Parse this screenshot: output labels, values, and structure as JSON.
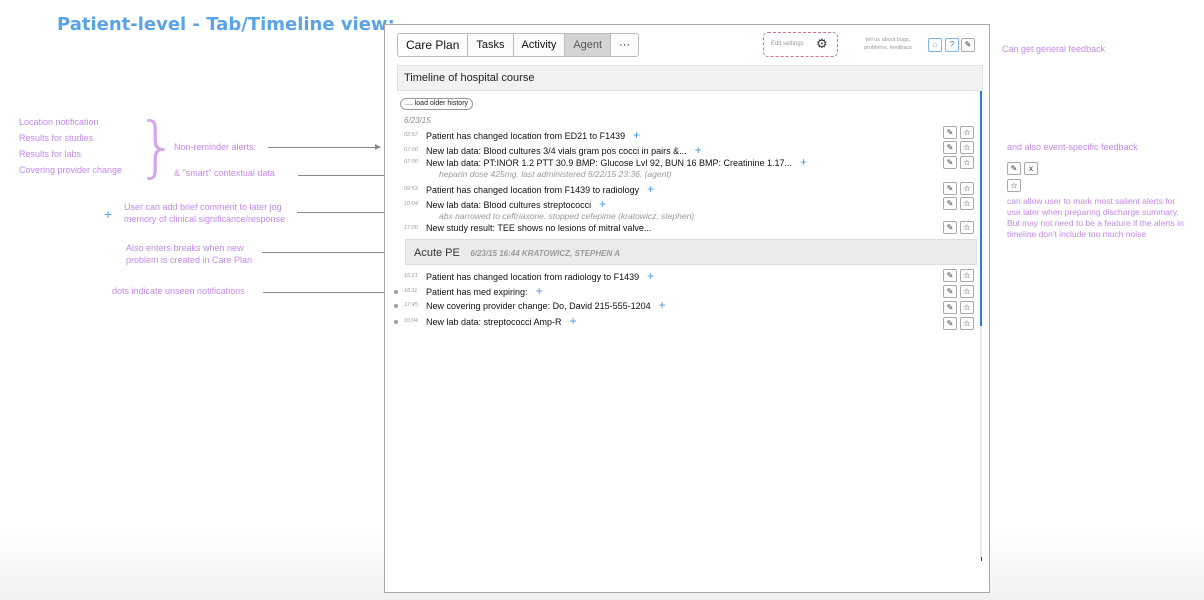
{
  "page": {
    "title": "Patient-level - Tab/Timeline view:"
  },
  "left_annotations": {
    "alert_types": [
      "Location notification",
      "Results for studies",
      "Results for labs",
      "Covering provider change"
    ],
    "non_reminder": "Non-reminder alerts:",
    "smart": "& \"smart\" contextual data",
    "comment_line1": "User can add brief comment to later jog",
    "comment_line2": "memory of clinical significance/response",
    "plus_glyph": "+",
    "breaks_line1": "Also enters breaks when new",
    "breaks_line2": "problem is created in Care Plan",
    "dots": "dots indicate unseen notifications"
  },
  "right_annotations": {
    "general_feedback": "Can get general feedback",
    "event_feedback": "and also event-specific feedback",
    "x_label": "x",
    "salient": "can allow user to mark most salient alerts for use later when preparing discharge summary.  But may not need to be a feature if the alerts in timeline don't include too much noise"
  },
  "tabs": [
    {
      "label": "Care Plan"
    },
    {
      "label": "Tasks"
    },
    {
      "label": "Activity"
    },
    {
      "label": "Agent"
    },
    {
      "label": "···"
    }
  ],
  "toolbar": {
    "edit_settings": "Edit settings",
    "tell_us": "tell us about bugs, problems, feedback",
    "help": "?"
  },
  "timeline": {
    "heading": "Timeline of hospital course",
    "load_older": ".... load older history",
    "date": "6/23/15",
    "plus_glyph": "+",
    "entries": [
      {
        "time": "02:57",
        "text": "Patient has changed location from ED21 to F1439"
      },
      {
        "time": "07:00",
        "text": "New lab data: Blood cultures 3/4 vials gram pos cocci in pairs &..."
      },
      {
        "time": "07:00",
        "text": "New lab data: PT:INOR 1.2 PTT 30.9 BMP: Glucose Lvl 92, BUN 16 BMP: Creatinine 1.17..."
      },
      {
        "time": "",
        "note": "heparin dose 425mg.  last administered 6/22/15 23:36. (agent)"
      },
      {
        "time": "09:53",
        "text": "Patient has changed location from F1439 to radiology"
      },
      {
        "time": "10:04",
        "text": "New lab data: Blood cultures streptococci"
      },
      {
        "time": "",
        "note": "abx narrowed to ceftriaxone.  stopped cefepime (kratowicz, stephen)"
      },
      {
        "time": "17:00",
        "text": "New study result: TEE shows no lesions of mitral valve..."
      },
      {
        "time": "15:21",
        "text": "Patient has changed location from radiology to F1439"
      },
      {
        "time": "16:11",
        "text": "Patient has med expiring:"
      },
      {
        "time": "17:45",
        "text": "New covering provider change: Do, David 215-555-1204"
      },
      {
        "time": "10:04",
        "text": "New lab data: streptococci Amp-R"
      }
    ],
    "problem_break": {
      "title": "Acute PE",
      "meta": "6/23/15 16:44 KRATOWICZ, STEPHEN A"
    }
  }
}
